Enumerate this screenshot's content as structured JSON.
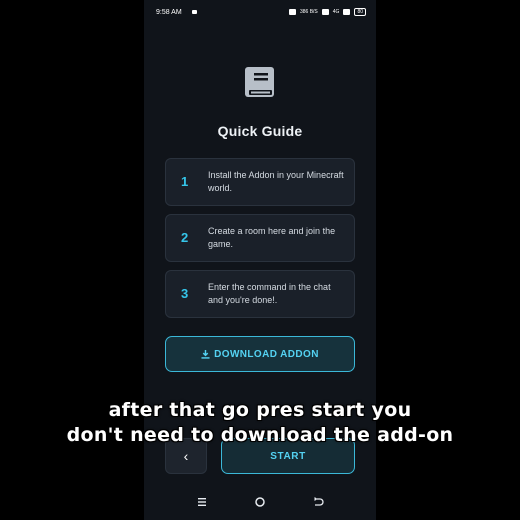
{
  "status_bar": {
    "time": "9:58 AM",
    "net_speed": "386 B/S",
    "signal": "4G",
    "battery": "80"
  },
  "header": {
    "icon": "book-icon",
    "title": "Quick Guide"
  },
  "steps": [
    {
      "number": "1",
      "text": "Install the Addon in your Minecraft world."
    },
    {
      "number": "2",
      "text": "Create a room here and join the game."
    },
    {
      "number": "3",
      "text": "Enter the command in the chat and you're done!."
    }
  ],
  "buttons": {
    "download_label": "DOWNLOAD ADDON",
    "back_symbol": "‹",
    "start_label": "START"
  },
  "captions": {
    "line1": "after that go pres start you",
    "line2": "don't need to download the add-on"
  },
  "colors": {
    "accent": "#35c6ea",
    "background": "#10141a",
    "card": "#1a2029"
  }
}
